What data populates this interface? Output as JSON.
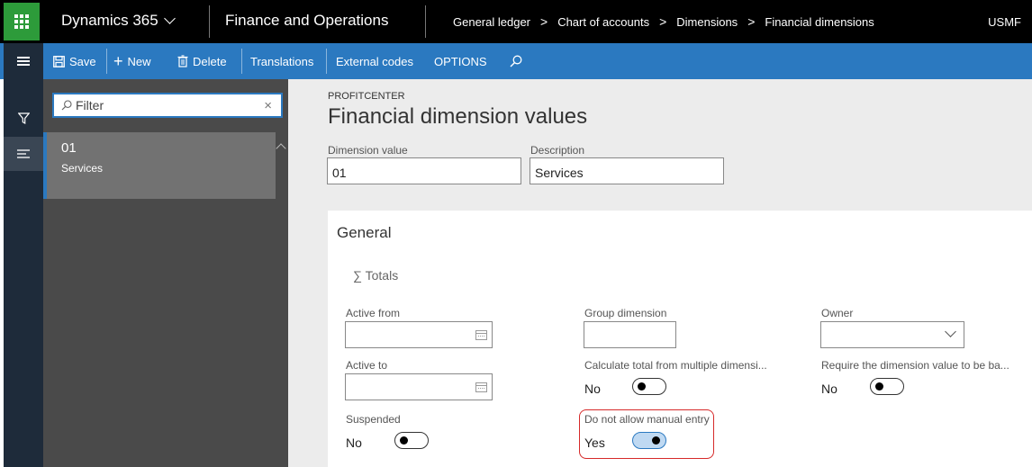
{
  "topbar": {
    "product": "Dynamics 365",
    "app": "Finance and Operations",
    "breadcrumbs": [
      "General ledger",
      "Chart of accounts",
      "Dimensions",
      "Financial dimensions"
    ],
    "company": "USMF"
  },
  "actionbar": {
    "save": "Save",
    "new": "New",
    "delete": "Delete",
    "translations": "Translations",
    "external_codes": "External codes",
    "options": "OPTIONS"
  },
  "list": {
    "filter_placeholder": "Filter",
    "items": [
      {
        "id": "01",
        "description": "Services"
      }
    ]
  },
  "form": {
    "caption": "PROFITCENTER",
    "title": "Financial dimension values",
    "dimension_value_label": "Dimension value",
    "dimension_value": "01",
    "description_label": "Description",
    "description": "Services"
  },
  "general": {
    "title": "General",
    "totals": "Totals",
    "active_from_label": "Active from",
    "active_to_label": "Active to",
    "suspended_label": "Suspended",
    "suspended_value": "No",
    "group_dimension_label": "Group dimension",
    "calc_total_label": "Calculate total from multiple dimensi...",
    "calc_total_value": "No",
    "no_manual_label": "Do not allow manual entry",
    "no_manual_value": "Yes",
    "owner_label": "Owner",
    "require_balanced_label": "Require the dimension value to be ba...",
    "require_balanced_value": "No"
  },
  "colors": {
    "accent": "#2b79c0",
    "nav_dark": "#1e2b3a",
    "waffle_green": "#2d9b3a",
    "highlight_red": "#d62a2a"
  }
}
